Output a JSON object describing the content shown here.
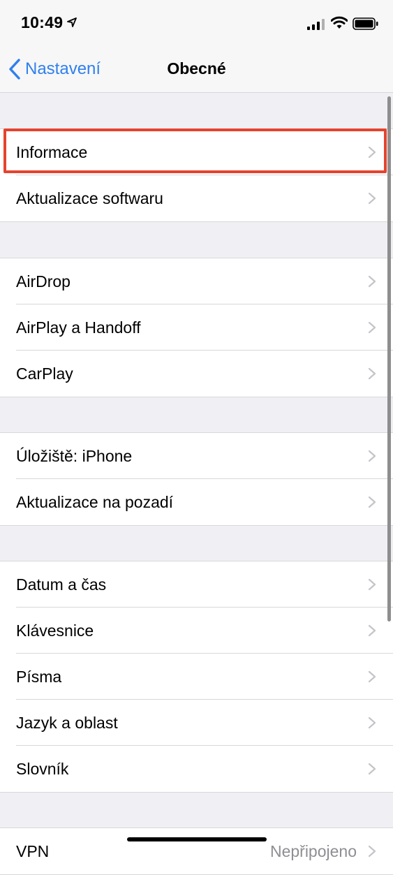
{
  "status_bar": {
    "time": "10:49"
  },
  "nav": {
    "back_label": "Nastavení",
    "title": "Obecné"
  },
  "groups": [
    {
      "rows": [
        {
          "label": "Informace",
          "value": ""
        },
        {
          "label": "Aktualizace softwaru",
          "value": ""
        }
      ]
    },
    {
      "rows": [
        {
          "label": "AirDrop",
          "value": ""
        },
        {
          "label": "AirPlay a Handoff",
          "value": ""
        },
        {
          "label": "CarPlay",
          "value": ""
        }
      ]
    },
    {
      "rows": [
        {
          "label": "Úložiště: iPhone",
          "value": ""
        },
        {
          "label": "Aktualizace na pozadí",
          "value": ""
        }
      ]
    },
    {
      "rows": [
        {
          "label": "Datum a čas",
          "value": ""
        },
        {
          "label": "Klávesnice",
          "value": ""
        },
        {
          "label": "Písma",
          "value": ""
        },
        {
          "label": "Jazyk a oblast",
          "value": ""
        },
        {
          "label": "Slovník",
          "value": ""
        }
      ]
    },
    {
      "rows": [
        {
          "label": "VPN",
          "value": "Nepřipojeno"
        }
      ]
    }
  ],
  "colors": {
    "accent": "#2f80ed",
    "highlight": "#e5432e"
  },
  "icons": [
    "location-arrow-icon",
    "cellular-signal-icon",
    "wifi-icon",
    "battery-icon",
    "chevron-left-icon",
    "chevron-right-icon"
  ]
}
